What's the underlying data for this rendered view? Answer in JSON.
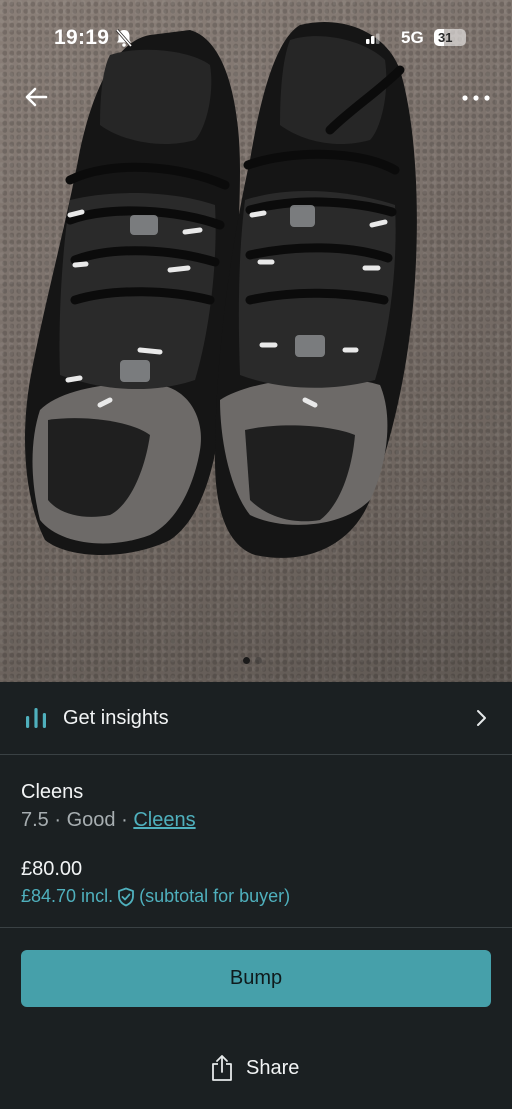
{
  "status_bar": {
    "time": "19:19",
    "network": "5G",
    "battery": "31",
    "battery_level": 0.31
  },
  "top_bar": {
    "back_icon": "back-arrow-icon",
    "more_icon": "more-dots-icon"
  },
  "gallery": {
    "total_photos": 2,
    "current_photo": 1
  },
  "insights": {
    "label": "Get insights",
    "icon": "bar-chart-icon"
  },
  "item": {
    "title": "Cleens",
    "size": "7.5",
    "separator": "·",
    "condition": "Good",
    "brand": "Cleens",
    "price": "£80.00",
    "price_incl": "£84.70 incl.",
    "subtotal_note": "(subtotal for buyer)"
  },
  "actions": {
    "bump_label": "Bump",
    "share_label": "Share"
  },
  "colors": {
    "accent": "#4fb0bd",
    "button": "#46a0aa",
    "background": "#1b2022"
  }
}
